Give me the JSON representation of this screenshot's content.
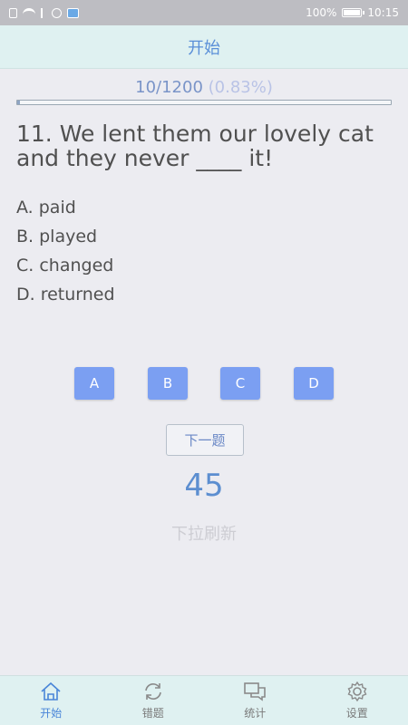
{
  "status_bar": {
    "battery": "100%",
    "battery_level": 1.0,
    "time": "10:15",
    "icons": [
      "sim-icon",
      "wifi-icon",
      "usb-icon",
      "globe-icon",
      "app-icon",
      "battery-icon"
    ]
  },
  "header": {
    "title": "开始"
  },
  "progress": {
    "count": "10/1200",
    "percent": "(0.83%)",
    "fraction": 0.0083
  },
  "question": {
    "text": "11. We lent them our lovely cat and they never ____ it!",
    "options": [
      "A. paid",
      "B. played",
      "C. changed",
      "D. returned"
    ]
  },
  "answer_buttons": [
    "A",
    "B",
    "C",
    "D"
  ],
  "next_button": "下一题",
  "countdown": "45",
  "pull_refresh": "下拉刷新",
  "tabs": [
    {
      "label": "开始",
      "icon": "home-icon",
      "active": true
    },
    {
      "label": "错题",
      "icon": "refresh-icon",
      "active": false
    },
    {
      "label": "统计",
      "icon": "chat-icon",
      "active": false
    },
    {
      "label": "设置",
      "icon": "gear-icon",
      "active": false
    }
  ],
  "colors": {
    "accent": "#5a8fd8",
    "button": "#7b9ff2",
    "header_bg": "#dff1f1",
    "page_bg": "#ececf1"
  }
}
